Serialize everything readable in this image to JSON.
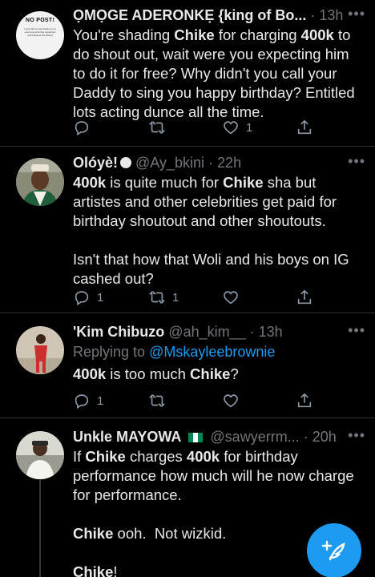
{
  "tweets": [
    {
      "avatar_text": "NO POST!",
      "avatar_subtext": "I just want to say thank you to everyone who has supported and followed this Brand",
      "name": "ỌMỌGE ADERONKẸ {king of Bo...",
      "handle": "",
      "time": "13h",
      "segments": [
        {
          "t": "You're shading "
        },
        {
          "t": "Chike",
          "b": true
        },
        {
          "t": " for charging "
        },
        {
          "t": "400k",
          "b": true
        },
        {
          "t": " to do shout out, wait were you expecting him to do it for free? Why didn't you call your Daddy to sing you happy birthday? Entitled lots acting dunce all the time."
        }
      ],
      "reply_count": "",
      "retweet_count": "",
      "like_count": "1"
    },
    {
      "name": "Olóyè!",
      "handle": "@Ay_bkini",
      "time": "22h",
      "segments": [
        {
          "t": "400k",
          "b": true
        },
        {
          "t": " is quite much for "
        },
        {
          "t": "Chike",
          "b": true
        },
        {
          "t": " sha but artistes and other celebrities get paid for birthday shoutout and other shoutouts.\n\nIsn't that how that Woli and his boys on IG cashed out?"
        }
      ],
      "reply_count": "1",
      "retweet_count": "1",
      "like_count": ""
    },
    {
      "name": "'Kim Chibuzo",
      "handle": "@ah_kim__",
      "time": "13h",
      "reply_prefix": "Replying to ",
      "reply_user": "@Mskayleebrownie",
      "segments": [
        {
          "t": "400k",
          "b": true
        },
        {
          "t": " is too much "
        },
        {
          "t": "Chike",
          "b": true
        },
        {
          "t": "?"
        }
      ],
      "reply_count": "1",
      "retweet_count": "",
      "like_count": ""
    },
    {
      "name": "Unkle MAYOWA",
      "handle": "@sawyerrm...",
      "time": "20h",
      "segments": [
        {
          "t": "If "
        },
        {
          "t": "Chike",
          "b": true
        },
        {
          "t": " charges "
        },
        {
          "t": "400k",
          "b": true
        },
        {
          "t": " for birthday performance how much will he now charge for performance.\n\n"
        },
        {
          "t": "Chike",
          "b": true
        },
        {
          "t": " ooh.  Not wizkid.\n\n"
        },
        {
          "t": "Chike",
          "b": true
        },
        {
          "t": "!"
        }
      ]
    }
  ],
  "dot": "·",
  "more": "•••",
  "colors": {
    "accent": "#1d9bf0",
    "muted": "#71767b",
    "background": "#000000"
  },
  "icons": [
    "reply-icon",
    "retweet-icon",
    "like-icon",
    "share-icon",
    "compose-icon",
    "more-icon"
  ]
}
